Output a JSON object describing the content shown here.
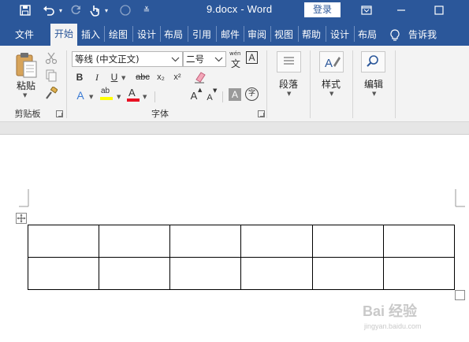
{
  "titlebar": {
    "doc_title": "9.docx  -  Word",
    "login_label": "登录"
  },
  "tabs": [
    {
      "label": "文件"
    },
    {
      "label": "开始"
    },
    {
      "label": "插入"
    },
    {
      "label": "绘图"
    },
    {
      "label": "设计"
    },
    {
      "label": "布局"
    },
    {
      "label": "引用"
    },
    {
      "label": "邮件"
    },
    {
      "label": "审阅"
    },
    {
      "label": "视图"
    },
    {
      "label": "帮助"
    },
    {
      "label": "设计"
    },
    {
      "label": "布局"
    },
    {
      "label": "告诉我"
    }
  ],
  "clipboard": {
    "paste_label": "粘贴",
    "group_label": "剪贴板"
  },
  "font": {
    "font_name": "等线 (中文正文)",
    "font_size": "二号",
    "group_label": "字体",
    "bold": "B",
    "italic": "I",
    "underline": "U",
    "strike": "abc",
    "subscript": "x₂",
    "superscript": "x²",
    "text_effects": "A",
    "highlight": "ab",
    "font_color": "A",
    "grow": "A",
    "shrink": "A",
    "char_shading": "A",
    "enclose": "字",
    "phonetic_top": "wén",
    "phonetic_char": "文",
    "char_border": "A"
  },
  "paragraph": {
    "label": "段落"
  },
  "styles": {
    "label": "样式"
  },
  "editing": {
    "label": "编辑"
  },
  "table": {
    "rows": 2,
    "cols": 6
  },
  "watermark": {
    "main": "Bai  经验",
    "sub": "jingyan.baidu.com"
  },
  "colors": {
    "brand": "#2b579a",
    "ribbon_bg": "#f3f3f3",
    "highlight_yellow": "#ffff00",
    "font_red": "#e81123"
  }
}
